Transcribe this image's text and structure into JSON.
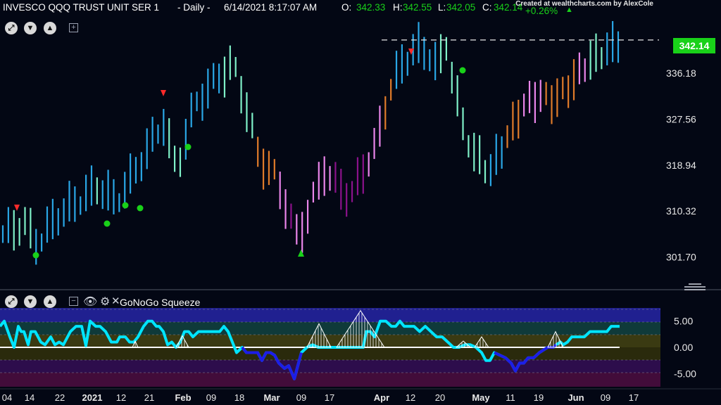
{
  "header": {
    "symbol": "INVESCO QQQ TRUST UNIT SER 1",
    "sep": "- Daily -",
    "datetime": "6/14/2021 8:17:07 AM",
    "o_label": "O:",
    "o": "342.33",
    "h_label": "H:",
    "h": "342.55",
    "l_label": "L:",
    "l": "342.05",
    "c_label": "C:",
    "c": "342.14",
    "change": "+0.26%",
    "credit": "Created at wealthcharts.com by AlexCole"
  },
  "colors": {
    "bg": "#030714",
    "strong_up": "#2aa7e6",
    "weak_up": "#7ff0c8",
    "neutral": "#e07b2a",
    "weak_down": "#ea85ea",
    "strong_down": "#8b128b",
    "green": "#19d119",
    "red": "#ff2a2a",
    "osc": "#00e5ff",
    "osc_strong": "#1d1de8"
  },
  "icons": [
    "expand-icon",
    "chevron-down-icon",
    "chevron-up-icon",
    "plus-box-icon",
    "eye-icon",
    "gear-icon",
    "close-icon",
    "minus-box-icon",
    "lines-icon"
  ],
  "panel": {
    "name": "GoNoGo Squeeze"
  },
  "last_price": "342.14",
  "chart_data": {
    "type": "candlestick",
    "title": "INVESCO QQQ TRUST UNIT SER 1",
    "y_ticks": [
      336.18,
      327.56,
      318.94,
      310.32,
      301.7
    ],
    "ylim": [
      296.5,
      347
    ],
    "x_ticks": [
      "04",
      "14",
      "22",
      "2021",
      "12",
      "21",
      "Feb",
      "09",
      "18",
      "Mar",
      "09",
      "17",
      "Apr",
      "12",
      "20",
      "May",
      "11",
      "19",
      "Jun",
      "09",
      "17"
    ],
    "last_value": 342.14,
    "resistance_level": 342.4,
    "oscillator": {
      "name": "GoNoGo Squeeze",
      "y_ticks": [
        5.0,
        0.0,
        -5.0
      ],
      "ylim": [
        -7.5,
        7.5
      ]
    }
  }
}
